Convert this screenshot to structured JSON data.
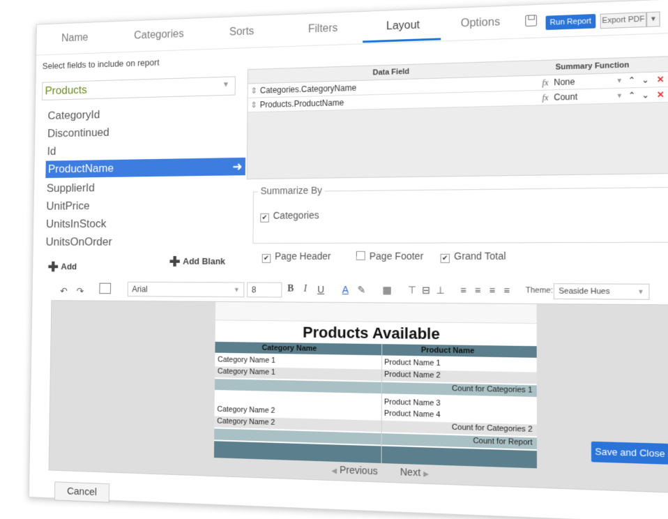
{
  "tabs": [
    {
      "label": "Name"
    },
    {
      "label": "Categories"
    },
    {
      "label": "Sorts"
    },
    {
      "label": "Filters"
    },
    {
      "label": "Layout"
    },
    {
      "label": "Options"
    }
  ],
  "active_tab": "Layout",
  "header": {
    "run_report": "Run Report",
    "export": "Export PDF"
  },
  "fields_panel": {
    "instruction": "Select fields to include on report",
    "table_select": "Products",
    "fields": [
      "CategoryId",
      "Discontinued",
      "Id",
      "ProductName",
      "SupplierId",
      "UnitPrice",
      "UnitsInStock",
      "UnitsOnOrder"
    ],
    "selected_field": "ProductName",
    "add": "Add",
    "add_blank": "Add Blank"
  },
  "grid": {
    "col_data_field": "Data Field",
    "col_summary": "Summary Function",
    "rows": [
      {
        "field": "Categories.CategoryName",
        "function": "None"
      },
      {
        "field": "Products.ProductName",
        "function": "Count"
      }
    ]
  },
  "summarize": {
    "legend": "Summarize By",
    "items": [
      {
        "label": "Categories",
        "checked": true
      }
    ]
  },
  "options": {
    "page_header": "Page Header",
    "page_footer": "Page Footer",
    "grand_total": "Grand Total",
    "page_header_checked": true,
    "page_footer_checked": false,
    "grand_total_checked": true
  },
  "toolbar": {
    "font": "Arial",
    "size": "8",
    "theme_label": "Theme:",
    "theme_value": "Seaside Hues"
  },
  "report": {
    "title": "Products Available",
    "col_category": "Category Name",
    "col_product": "Product Name",
    "cat1a": "Category Name 1",
    "cat1b": "Category Name 1",
    "prod1": "Product Name 1",
    "prod2": "Product Name 2",
    "count_cat1": "Count for Categories 1",
    "cat2a": "Category Name 2",
    "cat2b": "Category Name 2",
    "prod3": "Product Name 3",
    "prod4": "Product Name 4",
    "count_cat2": "Count for Categories 2",
    "count_report": "Count for Report"
  },
  "footer": {
    "previous": "Previous",
    "next": "Next",
    "save_close": "Save and Close",
    "cancel": "Cancel"
  },
  "colors": {
    "accent": "#2a74d9",
    "report_dark": "#5b7f8c",
    "report_light": "#a9c1c5"
  }
}
